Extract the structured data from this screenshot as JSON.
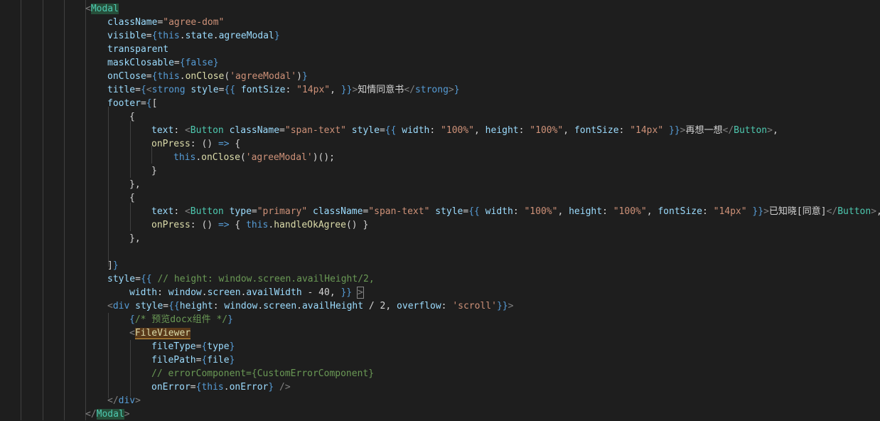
{
  "editor": {
    "language": "javascript-react",
    "colors": {
      "background": "#1e1e1e",
      "default": "#d4d4d4",
      "tag": "#4ec9b0",
      "bracket": "#808080",
      "attr": "#9cdcfe",
      "string": "#ce9178",
      "keyword": "#569cd6",
      "function": "#dcdcaa",
      "comment": "#6a9955"
    },
    "lines": [
      {
        "indent": 0,
        "tokens": [
          [
            "<",
            "bracket"
          ],
          [
            "Modal",
            "tag-hl"
          ]
        ]
      },
      {
        "indent": 1,
        "tokens": [
          [
            "className",
            "attr"
          ],
          [
            "=",
            "default"
          ],
          [
            "\"agree-dom\"",
            "string"
          ]
        ]
      },
      {
        "indent": 1,
        "tokens": [
          [
            "visible",
            "attr"
          ],
          [
            "=",
            "default"
          ],
          [
            "{",
            "keyword"
          ],
          [
            "this",
            "keyword"
          ],
          [
            ".",
            "default"
          ],
          [
            "state",
            "attr"
          ],
          [
            ".",
            "default"
          ],
          [
            "agreeModal",
            "attr"
          ],
          [
            "}",
            "keyword"
          ]
        ]
      },
      {
        "indent": 1,
        "tokens": [
          [
            "transparent",
            "attr"
          ]
        ]
      },
      {
        "indent": 1,
        "tokens": [
          [
            "maskClosable",
            "attr"
          ],
          [
            "=",
            "default"
          ],
          [
            "{",
            "keyword"
          ],
          [
            "false",
            "keyword"
          ],
          [
            "}",
            "keyword"
          ]
        ]
      },
      {
        "indent": 1,
        "tokens": [
          [
            "onClose",
            "attr"
          ],
          [
            "=",
            "default"
          ],
          [
            "{",
            "keyword"
          ],
          [
            "this",
            "keyword"
          ],
          [
            ".",
            "default"
          ],
          [
            "onClose",
            "function"
          ],
          [
            "(",
            "default"
          ],
          [
            "'agreeModal'",
            "string"
          ],
          [
            ")",
            "default"
          ],
          [
            "}",
            "keyword"
          ]
        ]
      },
      {
        "indent": 1,
        "tokens": [
          [
            "title",
            "attr"
          ],
          [
            "=",
            "default"
          ],
          [
            "{",
            "keyword"
          ],
          [
            "<",
            "bracket"
          ],
          [
            "strong",
            "keyword"
          ],
          [
            " ",
            "default"
          ],
          [
            "style",
            "attr"
          ],
          [
            "=",
            "default"
          ],
          [
            "{{",
            "keyword"
          ],
          [
            " fontSize",
            "attr"
          ],
          [
            ": ",
            "default"
          ],
          [
            "\"14px\"",
            "string"
          ],
          [
            ", ",
            "default"
          ],
          [
            "}}",
            "keyword"
          ],
          [
            ">",
            "bracket"
          ],
          [
            "知情同意书",
            "default"
          ],
          [
            "</",
            "bracket"
          ],
          [
            "strong",
            "keyword"
          ],
          [
            ">",
            "bracket"
          ],
          [
            "}",
            "keyword"
          ]
        ]
      },
      {
        "indent": 1,
        "tokens": [
          [
            "footer",
            "attr"
          ],
          [
            "=",
            "default"
          ],
          [
            "{",
            "keyword"
          ],
          [
            "[",
            "default"
          ]
        ]
      },
      {
        "indent": 2,
        "tokens": [
          [
            "{",
            "default"
          ]
        ]
      },
      {
        "indent": 3,
        "tokens": [
          [
            "text",
            "attr"
          ],
          [
            ": ",
            "default"
          ],
          [
            "<",
            "bracket"
          ],
          [
            "Button",
            "tag"
          ],
          [
            " ",
            "default"
          ],
          [
            "className",
            "attr"
          ],
          [
            "=",
            "default"
          ],
          [
            "\"span-text\"",
            "string"
          ],
          [
            " ",
            "default"
          ],
          [
            "style",
            "attr"
          ],
          [
            "=",
            "default"
          ],
          [
            "{{",
            "keyword"
          ],
          [
            " width",
            "attr"
          ],
          [
            ": ",
            "default"
          ],
          [
            "\"100%\"",
            "string"
          ],
          [
            ", ",
            "default"
          ],
          [
            "height",
            "attr"
          ],
          [
            ": ",
            "default"
          ],
          [
            "\"100%\"",
            "string"
          ],
          [
            ", ",
            "default"
          ],
          [
            "fontSize",
            "attr"
          ],
          [
            ": ",
            "default"
          ],
          [
            "\"14px\"",
            "string"
          ],
          [
            " ",
            "default"
          ],
          [
            "}}",
            "keyword"
          ],
          [
            ">",
            "bracket"
          ],
          [
            "再想一想",
            "default"
          ],
          [
            "</",
            "bracket"
          ],
          [
            "Button",
            "tag"
          ],
          [
            ">",
            "bracket"
          ],
          [
            ",",
            "default"
          ]
        ]
      },
      {
        "indent": 3,
        "tokens": [
          [
            "onPress",
            "function"
          ],
          [
            ": ",
            "default"
          ],
          [
            "() ",
            "default"
          ],
          [
            "=>",
            "keyword"
          ],
          [
            " {",
            "default"
          ]
        ]
      },
      {
        "indent": 4,
        "tokens": [
          [
            "this",
            "keyword"
          ],
          [
            ".",
            "default"
          ],
          [
            "onClose",
            "function"
          ],
          [
            "(",
            "default"
          ],
          [
            "'agreeModal'",
            "string"
          ],
          [
            ")();",
            "default"
          ]
        ]
      },
      {
        "indent": 3,
        "tokens": [
          [
            "}",
            "default"
          ]
        ]
      },
      {
        "indent": 2,
        "tokens": [
          [
            "},",
            "default"
          ]
        ]
      },
      {
        "indent": 2,
        "tokens": [
          [
            "{",
            "default"
          ]
        ]
      },
      {
        "indent": 3,
        "tokens": [
          [
            "text",
            "attr"
          ],
          [
            ": ",
            "default"
          ],
          [
            "<",
            "bracket"
          ],
          [
            "Button",
            "tag"
          ],
          [
            " ",
            "default"
          ],
          [
            "type",
            "attr"
          ],
          [
            "=",
            "default"
          ],
          [
            "\"primary\"",
            "string"
          ],
          [
            " ",
            "default"
          ],
          [
            "className",
            "attr"
          ],
          [
            "=",
            "default"
          ],
          [
            "\"span-text\"",
            "string"
          ],
          [
            " ",
            "default"
          ],
          [
            "style",
            "attr"
          ],
          [
            "=",
            "default"
          ],
          [
            "{{",
            "keyword"
          ],
          [
            " width",
            "attr"
          ],
          [
            ": ",
            "default"
          ],
          [
            "\"100%\"",
            "string"
          ],
          [
            ", ",
            "default"
          ],
          [
            "height",
            "attr"
          ],
          [
            ": ",
            "default"
          ],
          [
            "\"100%\"",
            "string"
          ],
          [
            ", ",
            "default"
          ],
          [
            "fontSize",
            "attr"
          ],
          [
            ": ",
            "default"
          ],
          [
            "\"14px\"",
            "string"
          ],
          [
            " ",
            "default"
          ],
          [
            "}}",
            "keyword"
          ],
          [
            ">",
            "bracket"
          ],
          [
            "已知晓[同意]",
            "default"
          ],
          [
            "</",
            "bracket"
          ],
          [
            "Button",
            "tag"
          ],
          [
            ">",
            "bracket"
          ],
          [
            ",",
            "default"
          ]
        ]
      },
      {
        "indent": 3,
        "tokens": [
          [
            "onPress",
            "function"
          ],
          [
            ": ",
            "default"
          ],
          [
            "() ",
            "default"
          ],
          [
            "=>",
            "keyword"
          ],
          [
            " { ",
            "default"
          ],
          [
            "this",
            "keyword"
          ],
          [
            ".",
            "default"
          ],
          [
            "handleOkAgree",
            "function"
          ],
          [
            "() }",
            "default"
          ]
        ]
      },
      {
        "indent": 2,
        "tokens": [
          [
            "},",
            "default"
          ]
        ]
      },
      {
        "indent": 0,
        "tokens": []
      },
      {
        "indent": 1,
        "tokens": [
          [
            "]",
            "default"
          ],
          [
            "}",
            "keyword"
          ]
        ]
      },
      {
        "indent": 1,
        "tokens": [
          [
            "style",
            "attr"
          ],
          [
            "=",
            "default"
          ],
          [
            "{{",
            "keyword"
          ],
          [
            " ",
            "default"
          ],
          [
            "// height: window.screen.availHeight/2,",
            "comment"
          ]
        ]
      },
      {
        "indent": 2,
        "tokens": [
          [
            "width",
            "attr"
          ],
          [
            ": ",
            "default"
          ],
          [
            "window",
            "attr"
          ],
          [
            ".",
            "default"
          ],
          [
            "screen",
            "attr"
          ],
          [
            ".",
            "default"
          ],
          [
            "availWidth",
            "attr"
          ],
          [
            " - ",
            "default"
          ],
          [
            "40",
            "default"
          ],
          [
            ", ",
            "default"
          ],
          [
            "}}",
            "keyword"
          ],
          [
            " ",
            "default"
          ],
          [
            ">",
            "bracket-box"
          ]
        ]
      },
      {
        "indent": 1,
        "tokens": [
          [
            "<",
            "bracket"
          ],
          [
            "div",
            "keyword"
          ],
          [
            " ",
            "default"
          ],
          [
            "style",
            "attr"
          ],
          [
            "=",
            "default"
          ],
          [
            "{{",
            "keyword"
          ],
          [
            "height",
            "attr"
          ],
          [
            ": ",
            "default"
          ],
          [
            "window",
            "attr"
          ],
          [
            ".",
            "default"
          ],
          [
            "screen",
            "attr"
          ],
          [
            ".",
            "default"
          ],
          [
            "availHeight",
            "attr"
          ],
          [
            " / 2, ",
            "default"
          ],
          [
            "overflow",
            "attr"
          ],
          [
            ": ",
            "default"
          ],
          [
            "'scroll'",
            "string"
          ],
          [
            "}}",
            "keyword"
          ],
          [
            ">",
            "bracket"
          ]
        ]
      },
      {
        "indent": 2,
        "tokens": [
          [
            "{",
            "keyword"
          ],
          [
            "/* 预览docx组件 */",
            "comment"
          ],
          [
            "}",
            "keyword"
          ]
        ]
      },
      {
        "indent": 2,
        "tokens": [
          [
            "<",
            "bracket"
          ],
          [
            "FileViewer",
            "tag-err"
          ]
        ]
      },
      {
        "indent": 3,
        "tokens": [
          [
            "fileType",
            "attr"
          ],
          [
            "=",
            "default"
          ],
          [
            "{",
            "keyword"
          ],
          [
            "type",
            "attr"
          ],
          [
            "}",
            "keyword"
          ]
        ]
      },
      {
        "indent": 3,
        "tokens": [
          [
            "filePath",
            "attr"
          ],
          [
            "=",
            "default"
          ],
          [
            "{",
            "keyword"
          ],
          [
            "file",
            "attr"
          ],
          [
            "}",
            "keyword"
          ]
        ]
      },
      {
        "indent": 3,
        "tokens": [
          [
            "// errorComponent={CustomErrorComponent}",
            "comment"
          ]
        ]
      },
      {
        "indent": 3,
        "tokens": [
          [
            "onError",
            "attr"
          ],
          [
            "=",
            "default"
          ],
          [
            "{",
            "keyword"
          ],
          [
            "this",
            "keyword"
          ],
          [
            ".",
            "default"
          ],
          [
            "onError",
            "attr"
          ],
          [
            "}",
            "keyword"
          ],
          [
            " ",
            "default"
          ],
          [
            "/>",
            "bracket"
          ]
        ]
      },
      {
        "indent": 1,
        "tokens": [
          [
            "</",
            "bracket"
          ],
          [
            "div",
            "keyword"
          ],
          [
            ">",
            "bracket"
          ]
        ]
      },
      {
        "indent": 0,
        "tokens": [
          [
            "</",
            "bracket"
          ],
          [
            "Modal",
            "tag-hl"
          ],
          [
            ">",
            "bracket"
          ]
        ]
      }
    ]
  }
}
